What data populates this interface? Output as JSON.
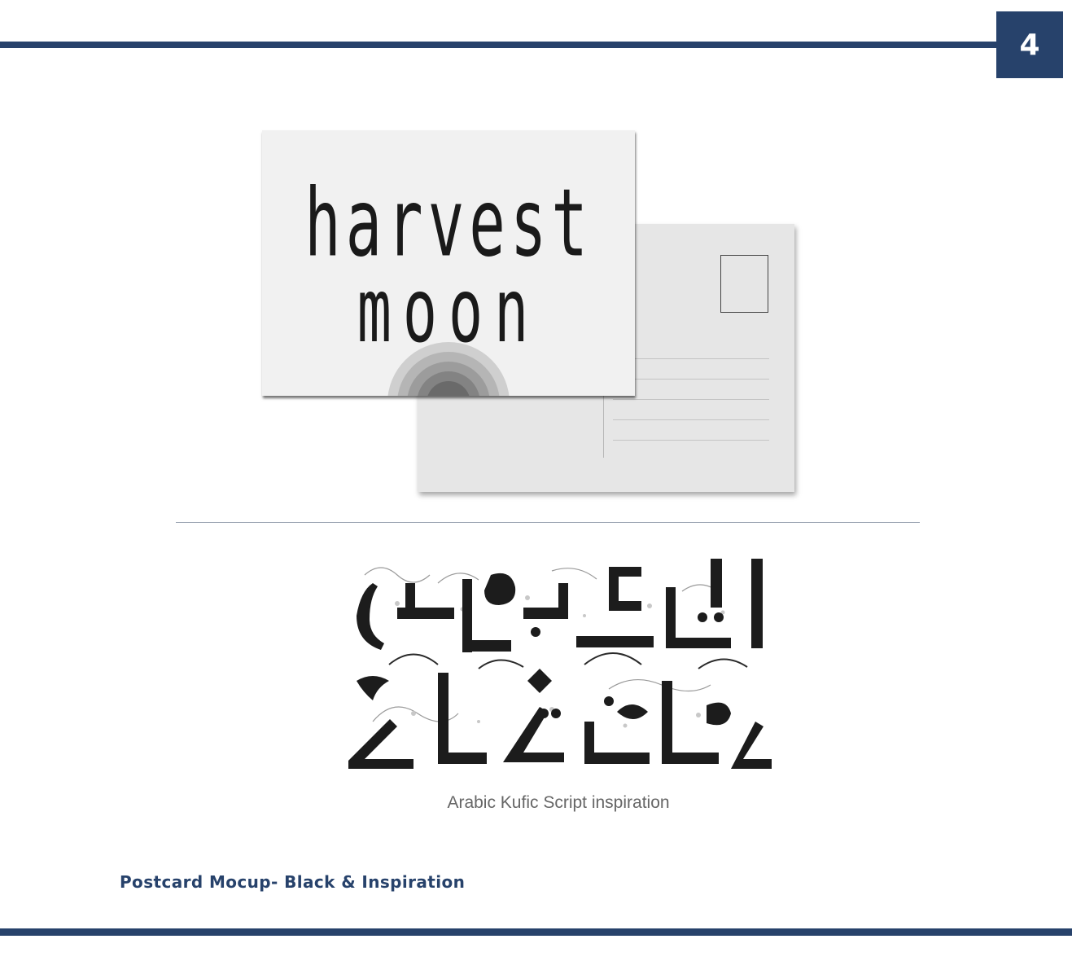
{
  "page": {
    "number": "4",
    "accent_color": "#27426b"
  },
  "postcard": {
    "front": {
      "title_line1": "harvest",
      "title_line2": "moon"
    },
    "back": {
      "stamp_box": true,
      "address_lines": 5
    }
  },
  "inspiration": {
    "caption": "Arabic Kufic Script inspiration"
  },
  "footer": {
    "section_title": "Postcard Mocup- Black & Inspiration"
  }
}
